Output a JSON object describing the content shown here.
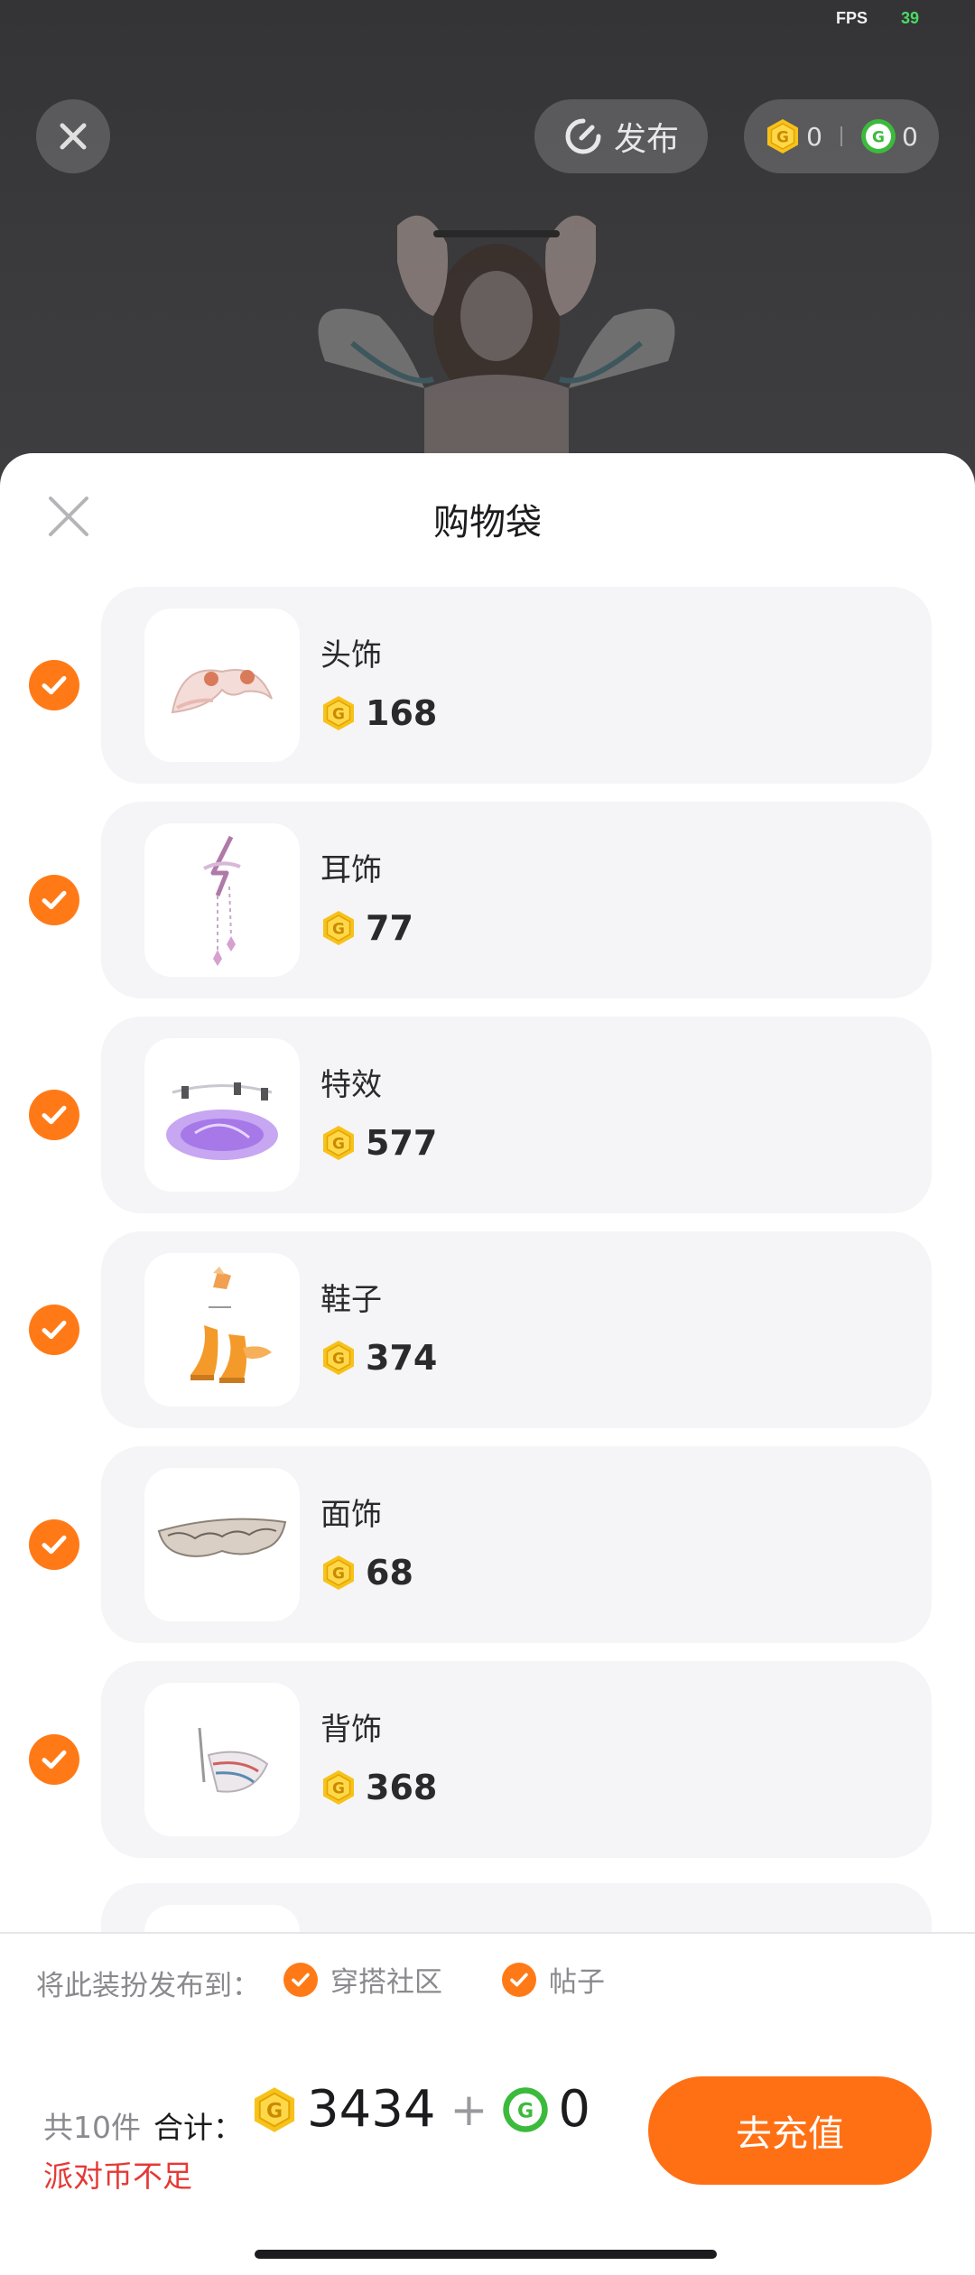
{
  "status": {
    "fps_label": "FPS",
    "fps_value": "39"
  },
  "topbar": {
    "publish_label": "发布",
    "gold_coins": "0",
    "green_coins": "0"
  },
  "sheet": {
    "title": "购物袋",
    "items": [
      {
        "name": "头饰",
        "price": "168",
        "icon": "headwear-thumbnail"
      },
      {
        "name": "耳饰",
        "price": "77",
        "icon": "earring-thumbnail"
      },
      {
        "name": "特效",
        "price": "577",
        "icon": "effect-thumbnail"
      },
      {
        "name": "鞋子",
        "price": "374",
        "icon": "shoes-thumbnail"
      },
      {
        "name": "面饰",
        "price": "68",
        "icon": "face-accessory-thumbnail"
      },
      {
        "name": "背饰",
        "price": "368",
        "icon": "back-accessory-thumbnail"
      }
    ]
  },
  "publish_to": {
    "label": "将此装扮发布到：",
    "options": [
      {
        "label": "穿搭社区",
        "checked": true
      },
      {
        "label": "帖子",
        "checked": true
      }
    ]
  },
  "footer": {
    "count_text": "共10件",
    "total_label": "合计：",
    "gold_total": "3434",
    "plus": "+",
    "green_total": "0",
    "warning": "派对币不足",
    "recharge_label": "去充值"
  },
  "colors": {
    "accent": "#ff7014",
    "check": "#ff7a17",
    "warning": "#e53935",
    "gold_coin": "#f5b800",
    "green_coin": "#3cba3c"
  }
}
